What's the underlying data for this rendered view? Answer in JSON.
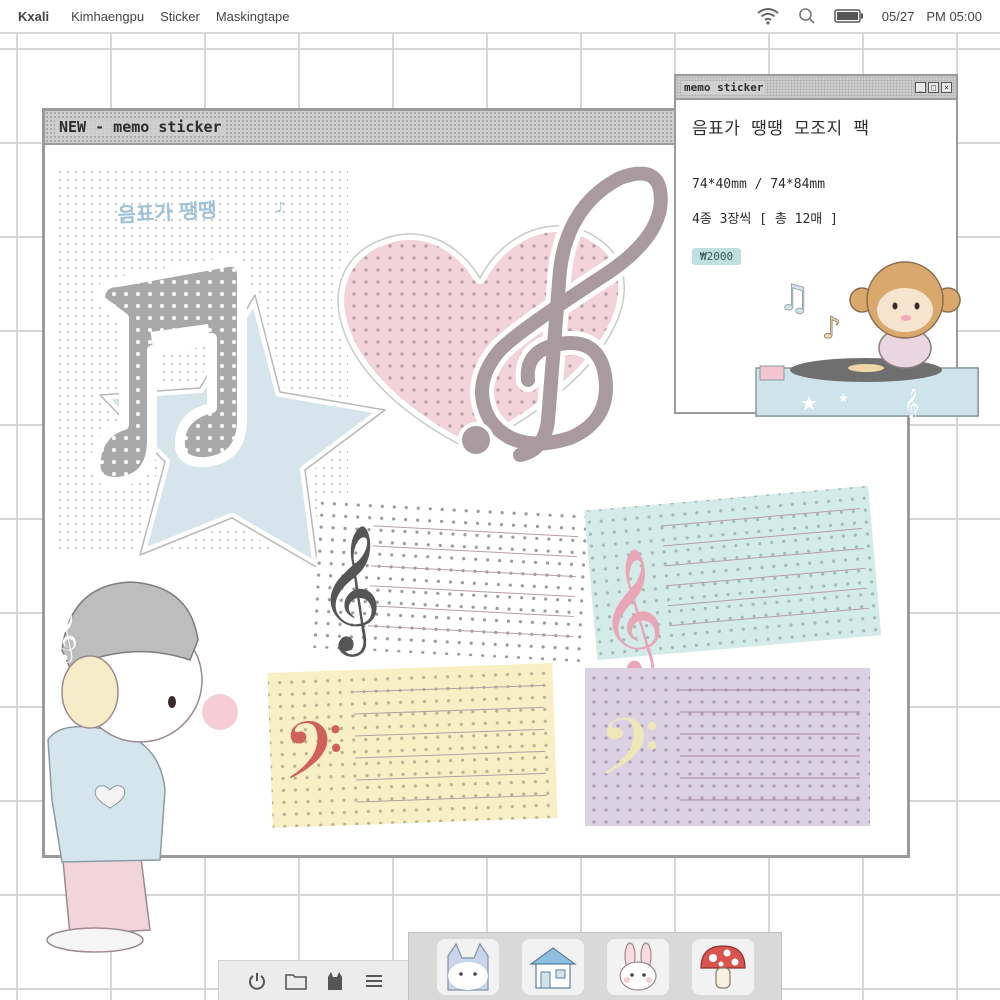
{
  "menubar": {
    "app_name": "Kxali",
    "menus": [
      "Kimhaengpu",
      "Sticker",
      "Maskingtape"
    ],
    "date": "05/27",
    "time": "PM 05:00",
    "status_icons": [
      "wifi-icon",
      "search-icon",
      "battery-icon"
    ]
  },
  "main_window": {
    "title": "NEW - memo sticker",
    "artwork_title": "음표가 땡땡"
  },
  "info_window": {
    "title": "memo sticker",
    "controls": [
      "_",
      "□",
      "×"
    ],
    "product_name": "음표가 땡땡 모조지 팩",
    "size": "74*40mm / 74*84mm",
    "count": "4종 3장씩 [ 총 12매 ]",
    "price": "₩2000"
  },
  "dock": {
    "utilities": [
      "power-icon",
      "folder-icon",
      "cat-icon",
      "menu-icon"
    ],
    "apps": [
      "cat-app-icon",
      "house-app-icon",
      "bunny-app-icon",
      "mushroom-app-icon"
    ]
  },
  "colors": {
    "grid": "#d6d6d6",
    "window_border": "#9a9a9a",
    "pink": "#f2d3da",
    "blue": "#d6e4ec",
    "mint": "#d4ece9",
    "yellow": "#f8f0c4",
    "lavender": "#dcd1e3",
    "gray_note": "#a8a8a8",
    "price_badge": "#bfe0e0"
  }
}
